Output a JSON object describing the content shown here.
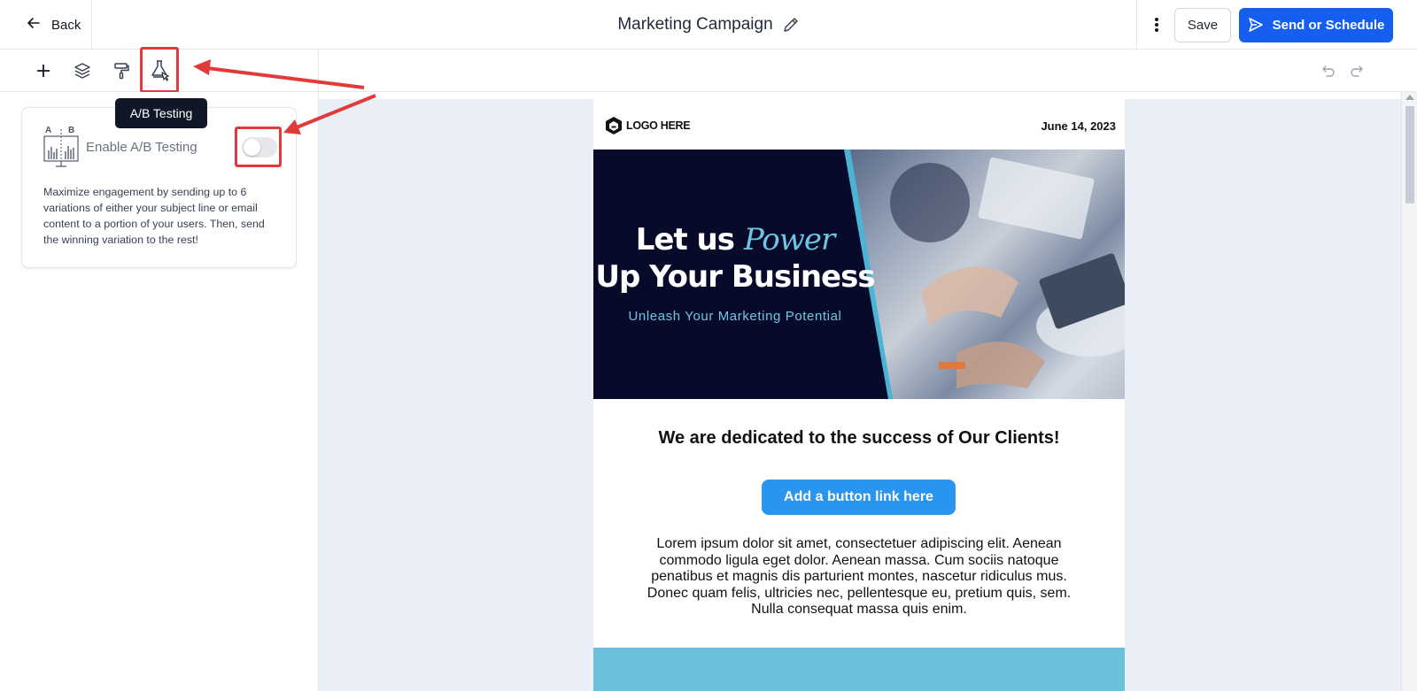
{
  "header": {
    "back_label": "Back",
    "title": "Marketing Campaign",
    "save_label": "Save",
    "send_label": "Send or Schedule"
  },
  "toolbar": {
    "tools": [
      "add-icon",
      "layers-icon",
      "paint-roller-icon",
      "flask-icon"
    ],
    "tooltip": "A/B Testing"
  },
  "ab_panel": {
    "icon_letters": "A  B",
    "label": "Enable A/B Testing",
    "enabled": false,
    "description": "Maximize engagement by sending up to 6 variations of either your subject line or email content to a portion of your users. Then, send the winning variation to the rest!"
  },
  "email": {
    "logo_text": "LOGO HERE",
    "date": "June 14, 2023",
    "hero_line1_a": "Let us ",
    "hero_line1_b": "Power",
    "hero_line2": "Up Your Business",
    "hero_sub": "Unleash Your Marketing Potential",
    "heading": "We are dedicated to the success of Our Clients!",
    "button_label": "Add a button link here",
    "body": "Lorem ipsum dolor sit amet, consectetuer adipiscing elit. Aenean commodo ligula eget dolor. Aenean massa. Cum sociis natoque penatibus et magnis dis parturient montes, nascetur ridiculus mus. Donec quam felis, ultricies nec, pellentesque eu, pretium quis, sem. Nulla consequat massa quis enim."
  },
  "colors": {
    "primary": "#155eef",
    "annotation_red": "#e03a3a",
    "email_button": "#2a95ee",
    "hero_dark": "#080a2a",
    "hero_accent": "#6fc6e4"
  }
}
